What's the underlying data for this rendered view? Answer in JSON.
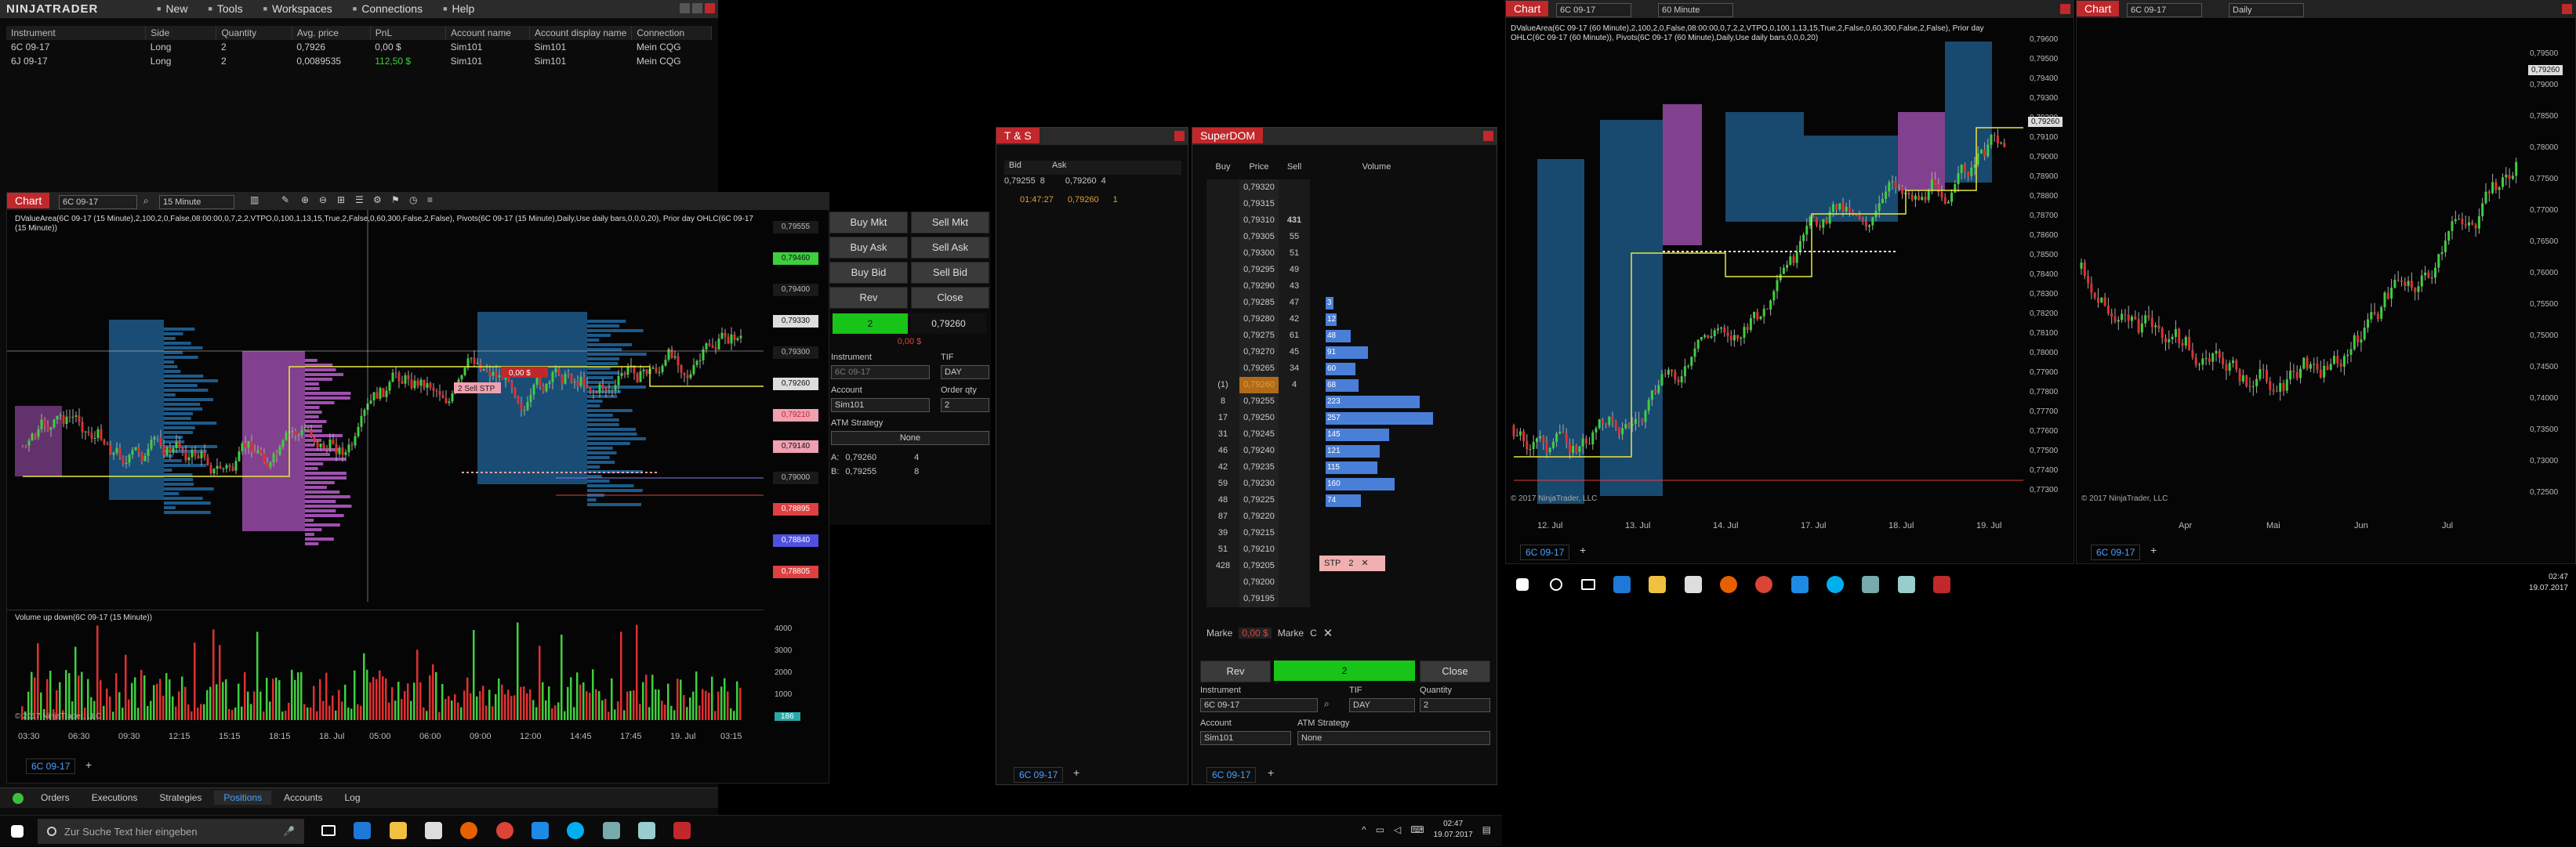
{
  "app": {
    "logo": "NINJATRADER",
    "menu": [
      {
        "label": "New",
        "icon": "new-icon"
      },
      {
        "label": "Tools",
        "icon": "tools-icon"
      },
      {
        "label": "Workspaces",
        "icon": "workspaces-icon"
      },
      {
        "label": "Connections",
        "icon": "connections-icon"
      },
      {
        "label": "Help",
        "icon": "help-icon"
      }
    ]
  },
  "positions": {
    "columns": [
      "Instrument",
      "Side",
      "Quantity",
      "Avg. price",
      "PnL",
      "Account name",
      "Account display name",
      "Connection"
    ],
    "rows": [
      [
        "6C 09-17",
        "Long",
        "2",
        "0,7926",
        "0,00 $",
        "Sim101",
        "Sim101",
        "Mein CQG"
      ],
      [
        "6J 09-17",
        "Long",
        "2",
        "0,0089535",
        "112,50 $",
        "Sim101",
        "Sim101",
        "Mein CQG"
      ]
    ],
    "pnl_colors": [
      "#cccccc",
      "#3ecf3e"
    ]
  },
  "chart1": {
    "tab": "Chart",
    "instrument": "6C 09-17",
    "interval": "15 Minute",
    "header_text": "DValueArea(6C 09-17 (15 Minute),2,100,2,0,False,08:00:00,0,7,2,2,VTPO,0,100,1,13,15,True,2,False,0,60,300,False,2,False), Pivots(6C 09-17 (15 Minute),Daily,Use daily bars,0,0,0,20), Prior day OHLC(6C 09-17 (15 Minute))",
    "volume_label": "Volume up down(6C 09-17 (15 Minute))",
    "copyright": "© 2017 NinjaTrader, LLC",
    "bottom_tab": "6C 09-17",
    "price_labels": [
      "0,79555",
      "0,79460",
      "0,79400",
      "0,79330",
      "0,79300",
      "0,79260",
      "0,79210",
      "0,79140",
      "0,79000",
      "0,78895",
      "0,78840",
      "0,78805"
    ],
    "vol_ticks": [
      "4000",
      "3000",
      "2000",
      "1000",
      "186"
    ],
    "x_ticks": [
      "03:30",
      "06:30",
      "09:30",
      "12:15",
      "15:15",
      "18:15",
      "18. Jul",
      "05:00",
      "06:00",
      "09:00",
      "12:00",
      "14:45",
      "17:45",
      "19. Jul",
      "03:15"
    ],
    "order_tag": "2 Sell STP",
    "pos_tag": "0,00 $"
  },
  "chart_trader": {
    "buy_mkt": "Buy Mkt",
    "sell_mkt": "Sell Mkt",
    "buy_ask": "Buy Ask",
    "sell_ask": "Sell Ask",
    "buy_bid": "Buy Bid",
    "sell_bid": "Sell Bid",
    "rev": "Rev",
    "close": "Close",
    "position_qty": "2",
    "position_price": "0,79260",
    "pnl": "0,00 $",
    "instrument_label": "Instrument",
    "tif_label": "TIF",
    "instrument": "6C 09-17",
    "tif": "DAY",
    "account_label": "Account",
    "orderqty_label": "Order qty",
    "account": "Sim101",
    "order_qty": "2",
    "atm_label": "ATM Strategy",
    "atm": "None",
    "ask_line": {
      "label": "A:",
      "price": "0,79260",
      "qty": "4"
    },
    "bid_line": {
      "label": "B:",
      "price": "0,79255",
      "qty": "8"
    }
  },
  "bottom_tabs": [
    "Orders",
    "Executions",
    "Strategies",
    "Positions",
    "Accounts",
    "Log"
  ],
  "ts": {
    "title": "T & S",
    "bid_label": "Bid",
    "ask_label": "Ask",
    "bid": "0,79255",
    "bid_qty": "8",
    "ask": "0,79260",
    "ask_qty": "4",
    "trade_time": "01:47:27",
    "trade_price": "0,79260",
    "trade_qty": "1",
    "bottom_tab": "6C 09-17"
  },
  "superdom": {
    "title": "SuperDOM",
    "col_buy": "Buy",
    "col_price": "Price",
    "col_sell": "Sell",
    "col_volume": "Volume",
    "rows": [
      {
        "buy": "",
        "price": "0,79320",
        "sell": "",
        "vol": ""
      },
      {
        "buy": "",
        "price": "0,79315",
        "sell": "",
        "vol": ""
      },
      {
        "buy": "",
        "price": "0,79310",
        "sell": "431",
        "vol": ""
      },
      {
        "buy": "",
        "price": "0,79305",
        "sell": "55",
        "vol": ""
      },
      {
        "buy": "",
        "price": "0,79300",
        "sell": "51",
        "vol": ""
      },
      {
        "buy": "",
        "price": "0,79295",
        "sell": "49",
        "vol": ""
      },
      {
        "buy": "",
        "price": "0,79290",
        "sell": "43",
        "vol": ""
      },
      {
        "buy": "",
        "price": "0,79285",
        "sell": "47",
        "vol": "3"
      },
      {
        "buy": "",
        "price": "0,79280",
        "sell": "42",
        "vol": "12"
      },
      {
        "buy": "",
        "price": "0,79275",
        "sell": "61",
        "vol": "48"
      },
      {
        "buy": "",
        "price": "0,79270",
        "sell": "45",
        "vol": "91"
      },
      {
        "buy": "",
        "price": "0,79265",
        "sell": "34",
        "vol": "60"
      },
      {
        "buy": "(1)",
        "price": "0,79260",
        "sell": "4",
        "vol": "68"
      },
      {
        "buy": "8",
        "price": "0,79255",
        "sell": "",
        "vol": "223"
      },
      {
        "buy": "17",
        "price": "0,79250",
        "sell": "",
        "vol": "257"
      },
      {
        "buy": "31",
        "price": "0,79245",
        "sell": "",
        "vol": "145"
      },
      {
        "buy": "46",
        "price": "0,79240",
        "sell": "",
        "vol": "121"
      },
      {
        "buy": "42",
        "price": "0,79235",
        "sell": "",
        "vol": "115"
      },
      {
        "buy": "59",
        "price": "0,79230",
        "sell": "",
        "vol": "160"
      },
      {
        "buy": "48",
        "price": "0,79225",
        "sell": "",
        "vol": "74"
      },
      {
        "buy": "87",
        "price": "0,79220",
        "sell": "",
        "vol": ""
      },
      {
        "buy": "39",
        "price": "0,79215",
        "sell": "",
        "vol": ""
      },
      {
        "buy": "51",
        "price": "0,79210",
        "sell": "",
        "vol": ""
      },
      {
        "buy": "428",
        "price": "0,79205",
        "sell": "",
        "vol": ""
      },
      {
        "buy": "",
        "price": "0,79200",
        "sell": "",
        "vol": ""
      },
      {
        "buy": "",
        "price": "0,79195",
        "sell": "",
        "vol": ""
      }
    ],
    "stop_tag": "STP",
    "stop_qty": "2",
    "market_left": "Marke",
    "market_right": "Marke",
    "pnl": "0,00 $",
    "c": "C",
    "rev": "Rev",
    "pos_qty": "2",
    "close": "Close",
    "instrument_label": "Instrument",
    "tif_label": "TIF",
    "qty_label": "Quantity",
    "instrument": "6C 09-17",
    "tif": "DAY",
    "qty": "2",
    "account_label": "Account",
    "atm_label": "ATM Strategy",
    "account": "Sim101",
    "atm": "None",
    "bottom_tab": "6C 09-17"
  },
  "chart2": {
    "tab": "Chart",
    "instrument": "6C 09-17",
    "interval": "60 Minute",
    "header_text": "DValueArea(6C 09-17 (60 Minute),2,100,2,0,False,08:00:00,0,7,2,2,VTPO,0,100,1,13,15,True,2,False,0,60,300,False,2,False), Prior day OHLC(6C 09-17 (60 Minute)), Pivots(6C 09-17 (60 Minute),Daily,Use daily bars,0,0,0,20)",
    "price_ticks": [
      "0,79600",
      "0,79500",
      "0,79400",
      "0,79300",
      "0,79200",
      "0,79100",
      "0,79000",
      "0,78900",
      "0,78800",
      "0,78700",
      "0,78600",
      "0,78500",
      "0,78400",
      "0,78300",
      "0,78200",
      "0,78100",
      "0,78000",
      "0,77900",
      "0,77800",
      "0,77700",
      "0,77600",
      "0,77500",
      "0,77400",
      "0,77300"
    ],
    "current_price": "0,79260",
    "x_ticks": [
      "12. Jul",
      "13. Jul",
      "14. Jul",
      "17. Jul",
      "18. Jul",
      "19. Jul"
    ],
    "copyright": "© 2017 NinjaTrader, LLC",
    "bottom_tab": "6C 09-17"
  },
  "chart3": {
    "tab": "Chart",
    "instrument": "6C 09-17",
    "interval": "Daily",
    "price_ticks": [
      "0,79500",
      "0,79000",
      "0,78500",
      "0,78000",
      "0,77500",
      "0,77000",
      "0,76500",
      "0,76000",
      "0,75500",
      "0,75000",
      "0,74500",
      "0,74000",
      "0,73500",
      "0,73000",
      "0,72500"
    ],
    "current_price": "0,79260",
    "x_ticks": [
      "Apr",
      "Mai",
      "Jun",
      "Jul"
    ],
    "copyright": "© 2017 NinjaTrader, LLC",
    "bottom_tab": "6C 09-17"
  },
  "taskbar": {
    "search_placeholder": "Zur Suche Text hier eingeben",
    "time": "02:47",
    "date": "19.07.2017"
  }
}
